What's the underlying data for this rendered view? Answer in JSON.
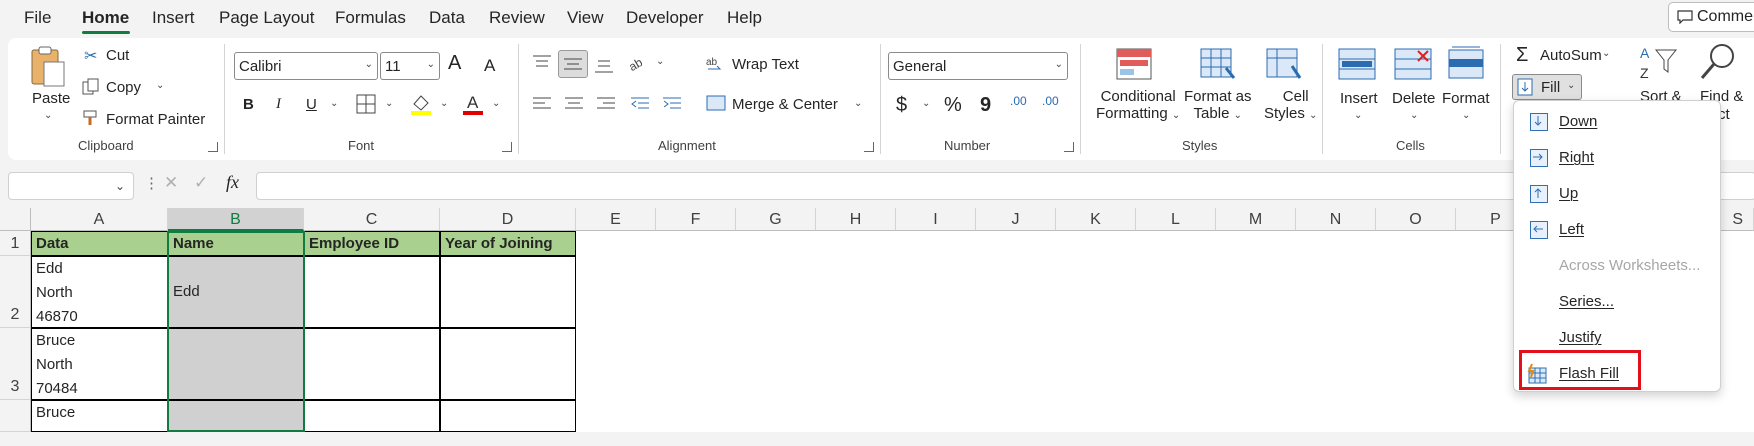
{
  "menu": {
    "file": "File",
    "home": "Home",
    "insert": "Insert",
    "page_layout": "Page Layout",
    "formulas": "Formulas",
    "data": "Data",
    "review": "Review",
    "view": "View",
    "developer": "Developer",
    "help": "Help",
    "comments": "Comme"
  },
  "clipboard": {
    "paste": "Paste",
    "cut": "Cut",
    "copy": "Copy",
    "format_painter": "Format Painter",
    "group": "Clipboard"
  },
  "font": {
    "name": "Calibri",
    "size": "11",
    "bold": "B",
    "italic": "I",
    "underline": "U",
    "group": "Font",
    "grow": "A",
    "shrink": "A",
    "color_a": "A",
    "highlight_color": "#ffff00",
    "font_color": "#e00000"
  },
  "alignment": {
    "wrap_text": "Wrap Text",
    "merge_center": "Merge & Center",
    "group": "Alignment"
  },
  "number": {
    "format": "General",
    "currency": "$",
    "percent": "%",
    "comma": "9",
    "inc_dec": ".00",
    "dec_dec": ".00",
    "group": "Number"
  },
  "styles": {
    "conditional": "Conditional",
    "formatting": "Formatting",
    "format_as": "Format as",
    "table": "Table",
    "cell": "Cell",
    "cell_styles": "Styles",
    "group": "Styles"
  },
  "cells": {
    "insert": "Insert",
    "delete": "Delete",
    "format": "Format",
    "group": "Cells"
  },
  "editing": {
    "autosum": "AutoSum",
    "fill": "Fill",
    "sort": "Sort &",
    "find": "Find &",
    "find2": "ct"
  },
  "formula_bar": {
    "fx": "fx"
  },
  "columns": [
    "A",
    "B",
    "C",
    "D",
    "E",
    "F",
    "G",
    "H",
    "I",
    "J",
    "K",
    "L",
    "M",
    "N",
    "O",
    "P",
    "S"
  ],
  "rows": [
    "1",
    "2",
    "3"
  ],
  "table": {
    "headers": [
      "Data",
      "Name",
      "Employee ID",
      "Year of Joining"
    ],
    "row2": {
      "a": [
        "Edd",
        "North",
        "46870"
      ],
      "b": "Edd"
    },
    "row3": {
      "a": [
        "Bruce",
        "North",
        "70484"
      ]
    },
    "row4": {
      "a": [
        "Bruce"
      ]
    }
  },
  "fill_menu": {
    "items": [
      {
        "label": "Down",
        "disabled": false
      },
      {
        "label": "Right",
        "disabled": false
      },
      {
        "label": "Up",
        "disabled": false
      },
      {
        "label": "Left",
        "disabled": false
      },
      {
        "label": "Across Worksheets...",
        "disabled": true
      },
      {
        "label": "Series...",
        "disabled": false
      },
      {
        "label": "Justify",
        "disabled": false
      },
      {
        "label": "Flash Fill",
        "disabled": false
      }
    ],
    "highlighted": "Flash Fill",
    "highlight_color": "#e3101c"
  },
  "colors": {
    "accent": "#107c41",
    "header_fill": "#a9d08e",
    "selected_col": "#d0d0d0"
  }
}
